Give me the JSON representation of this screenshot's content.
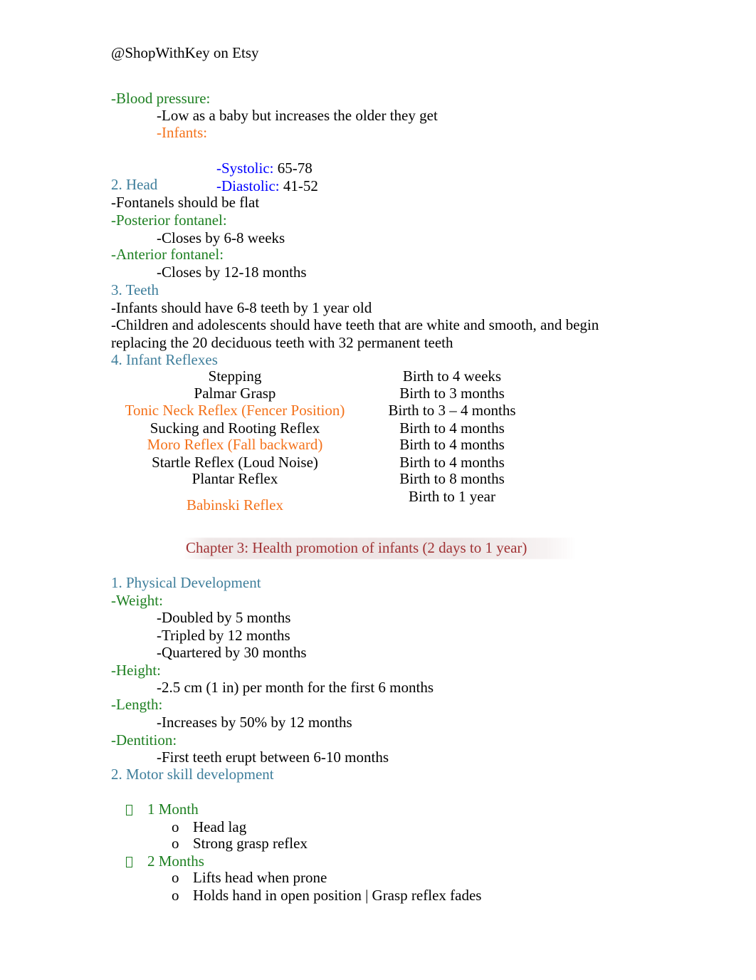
{
  "document": {
    "header": "@ShopWithKey on Etsy",
    "colors": {
      "black": "#000000",
      "green": "#1e8022",
      "blue": "#0000ff",
      "steel_blue": "#3e7e9b",
      "orange": "#f4721b",
      "maroon": "#a03234",
      "highlight": "#e2d4d4"
    }
  },
  "blood_pressure": {
    "title": "-Blood pressure:",
    "note": "-Low as a baby but increases the older they get",
    "infants_label": "-Infants:",
    "systolic_label": "-Systolic:",
    "systolic_value": " 65-78",
    "diastolic_label": "-Diastolic:",
    "diastolic_value": " 41-52"
  },
  "head": {
    "heading": "2. Head",
    "line1": "-Fontanels should be flat",
    "posterior_label": "-Posterior fontanel:",
    "posterior_detail": "-Closes by 6-8 weeks",
    "anterior_label": "-Anterior fontanel:",
    "anterior_detail": "-Closes by 12-18 months"
  },
  "teeth": {
    "heading": "3. Teeth",
    "line1": "-Infants should have 6-8 teeth by 1 year old",
    "line2": "-Children and adolescents should have teeth that are white and smooth, and begin",
    "line3": "replacing the 20 deciduous teeth with 32 permanent teeth"
  },
  "reflexes": {
    "heading": "4. Infant Reflexes",
    "names": [
      {
        "text": "Stepping",
        "color": "black"
      },
      {
        "text": "Palmar Grasp",
        "color": "black"
      },
      {
        "text": "Tonic Neck Reflex (Fencer Position)",
        "color": "orange"
      },
      {
        "text": "Sucking and Rooting Reflex",
        "color": "black"
      },
      {
        "text": "Moro Reflex (Fall backward)",
        "color": "orange"
      },
      {
        "text": "Startle Reflex (Loud Noise)",
        "color": "black"
      },
      {
        "text": "Plantar Reflex",
        "color": "black"
      },
      {
        "text": "Babinski Reflex",
        "color": "orange"
      }
    ],
    "durations": [
      "Birth to 4 weeks",
      "Birth to 3 months",
      "Birth to 3 – 4 months",
      "Birth to 4 months",
      "Birth to 4 months",
      "Birth to 4 months",
      "Birth to 8 months",
      "Birth to 1 year"
    ]
  },
  "chapter": {
    "title": "Chapter 3: Health promotion of infants (2 days to 1 year)"
  },
  "physical_development": {
    "heading": "1. Physical Development",
    "weight_label": "-Weight:",
    "weight_items": [
      "-Doubled by 5 months",
      "-Tripled by 12 months",
      "-Quartered by 30 months"
    ],
    "height_label": "-Height:",
    "height_item": "-2.5 cm (1 in) per month for the first 6 months",
    "length_label": "-Length:",
    "length_item": "-Increases by 50% by 12 months",
    "dentition_label": "-Dentition:",
    "dentition_item": "-First teeth erupt between 6-10 months"
  },
  "motor_skills": {
    "heading": "2. Motor skill development",
    "groups": [
      {
        "age": "1 Month",
        "items": [
          "Head lag",
          "Strong grasp reflex"
        ]
      },
      {
        "age": "2 Months",
        "items": [
          "Lifts head when prone",
          "Holds hand in open position | Grasp reflex fades"
        ]
      }
    ],
    "sub_bullet_mark": "o"
  }
}
